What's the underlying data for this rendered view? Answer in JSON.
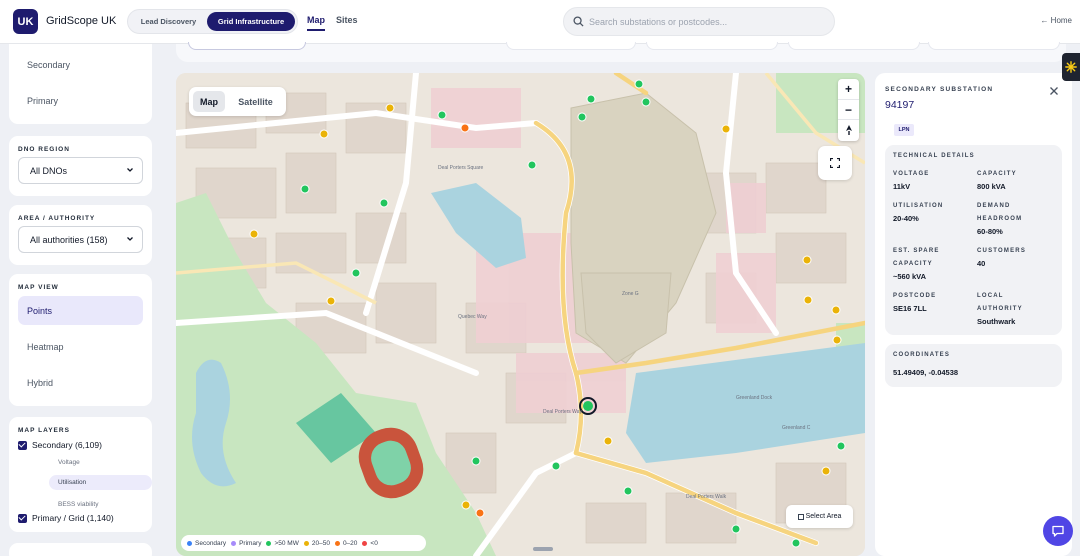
{
  "brand": {
    "logo": "UK",
    "name": "GridScope UK"
  },
  "mode_toggle": {
    "options": [
      "Lead Discovery",
      "Grid Infrastructure"
    ],
    "selected": "Grid Infrastructure"
  },
  "nav": {
    "map": "Map",
    "sites": "Sites",
    "active": "Map"
  },
  "search": {
    "placeholder": "Search substations or postcodes...",
    "value": ""
  },
  "home_link": "← Home",
  "sidebar": {
    "level_options": [
      "Secondary",
      "Primary"
    ],
    "dno_region": {
      "label": "DNO REGION",
      "value": "All DNOs"
    },
    "area_authority": {
      "label": "AREA / AUTHORITY",
      "value": "All authorities (158)"
    },
    "map_view": {
      "label": "MAP VIEW",
      "options": [
        "Points",
        "Heatmap",
        "Hybrid"
      ],
      "selected": "Points"
    },
    "map_layers": {
      "label": "MAP LAYERS",
      "secondary": {
        "label": "Secondary (6,109)",
        "checked": true
      },
      "secondary_sub": [
        "Voltage",
        "Utilisation",
        "BESS viability"
      ],
      "secondary_sub_selected": "Utilisation",
      "primary": {
        "label": "Primary / Grid (1,140)",
        "checked": true
      }
    }
  },
  "map": {
    "toggle": {
      "map": "Map",
      "satellite": "Satellite",
      "selected": "Map"
    },
    "zoom_in": "+",
    "zoom_out": "−",
    "select_area": "Select Area",
    "place_labels": [
      "Zone G",
      "Greenland C",
      "Deal Porters Way",
      "Deal Porters Square",
      "Greenland Dock",
      "Quebec Way",
      "Deal Porters Walk"
    ],
    "legend": [
      {
        "label": "Secondary",
        "color": "#3b82f6"
      },
      {
        "label": "Primary",
        "color": "#a78bfa"
      },
      {
        "label": ">50 MW",
        "color": "#22c55e"
      },
      {
        "label": "20–50",
        "color": "#eab308"
      },
      {
        "label": "0–20",
        "color": "#f97316"
      },
      {
        "label": "<0",
        "color": "#ef4444"
      }
    ]
  },
  "panel": {
    "type_label": "SECONDARY SUBSTATION",
    "id": "94197",
    "badge": "LPN",
    "technical_label": "TECHNICAL DETAILS",
    "details": {
      "voltage": {
        "label": "VOLTAGE",
        "value": "11kV"
      },
      "capacity": {
        "label": "CAPACITY",
        "value": "800 kVA"
      },
      "utilisation": {
        "label": "UTILISATION",
        "value": "20-40%"
      },
      "demand_headroom": {
        "label": "DEMAND HEADROOM",
        "value": "60-80%"
      },
      "spare_capacity": {
        "label": "EST. SPARE CAPACITY",
        "value": "~560 kVA"
      },
      "customers": {
        "label": "CUSTOMERS",
        "value": "40"
      },
      "postcode": {
        "label": "POSTCODE",
        "value": "SE16 7LL"
      },
      "local_authority": {
        "label": "LOCAL AUTHORITY",
        "value": "Southwark"
      }
    },
    "coordinates_label": "COORDINATES",
    "coordinates": "51.49409, -0.04538"
  },
  "colors": {
    "brand": "#1e1b6e",
    "accent": "#5046e5",
    "green": "#22c55e",
    "amber": "#eab308",
    "orange": "#f97316",
    "red": "#ef4444"
  }
}
